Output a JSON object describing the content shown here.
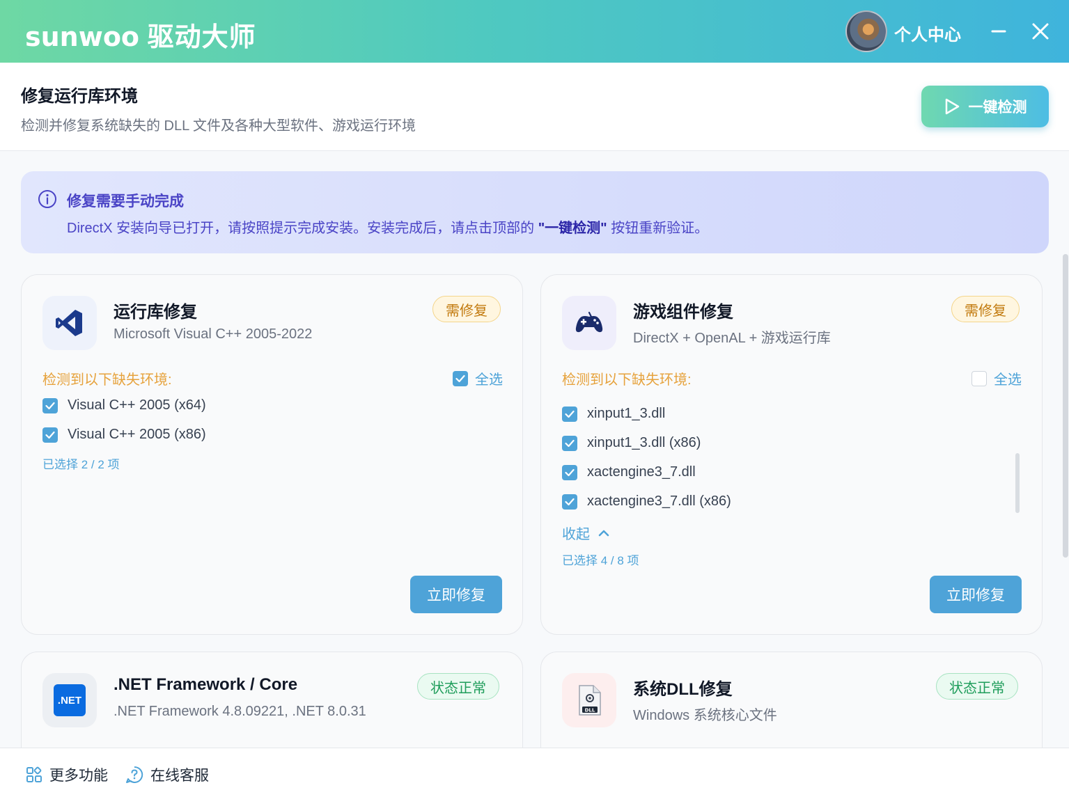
{
  "titlebar": {
    "brand_en": "sunwoo",
    "brand_cn": "驱动大师",
    "user_label": "个人中心"
  },
  "header": {
    "title": "修复运行库环境",
    "subtitle": "检测并修复系统缺失的 DLL 文件及各种大型软件、游戏运行环境",
    "detect_button": "一键检测"
  },
  "notice": {
    "title": "修复需要手动完成",
    "body_before": "DirectX 安装向导已打开，请按照提示完成安装。安装完成后，请点击顶部的 ",
    "body_bold": "\"一键检测\"",
    "body_after": " 按钮重新验证。"
  },
  "cards": [
    {
      "title": "运行库修复",
      "subtitle": "Microsoft Visual C++ 2005-2022",
      "badge": "需修复",
      "missing_label": "检测到以下缺失环境:",
      "select_all": "全选",
      "select_all_checked": true,
      "items": [
        "Visual C++ 2005 (x64)",
        "Visual C++ 2005 (x86)"
      ],
      "selected_count": "已选择 2 / 2 项",
      "repair_button": "立即修复",
      "icon": "visual-studio-icon"
    },
    {
      "title": "游戏组件修复",
      "subtitle": "DirectX + OpenAL + 游戏运行库",
      "badge": "需修复",
      "missing_label": "检测到以下缺失环境:",
      "select_all": "全选",
      "select_all_checked": false,
      "items": [
        "xinput1_3.dll",
        "xinput1_3.dll (x86)",
        "xactengine3_7.dll",
        "xactengine3_7.dll (x86)"
      ],
      "collapse": "收起",
      "selected_count": "已选择 4 / 8 项",
      "repair_button": "立即修复",
      "icon": "gamepad-icon"
    },
    {
      "title": ".NET Framework / Core",
      "subtitle": ".NET Framework 4.8.09221, .NET 8.0.31",
      "badge": "状态正常",
      "icon_text": ".NET",
      "icon": "dotnet-icon"
    },
    {
      "title": "系统DLL修复",
      "subtitle": "Windows 系统核心文件",
      "badge": "状态正常",
      "icon_text": "DLL",
      "icon": "dll-file-icon"
    }
  ],
  "footer": {
    "more": "更多功能",
    "support": "在线客服"
  },
  "colors": {
    "accent": "#4ea3d8",
    "warn": "#e6a23c",
    "ok": "#1f9d5b",
    "notice": "#4a44c6"
  }
}
